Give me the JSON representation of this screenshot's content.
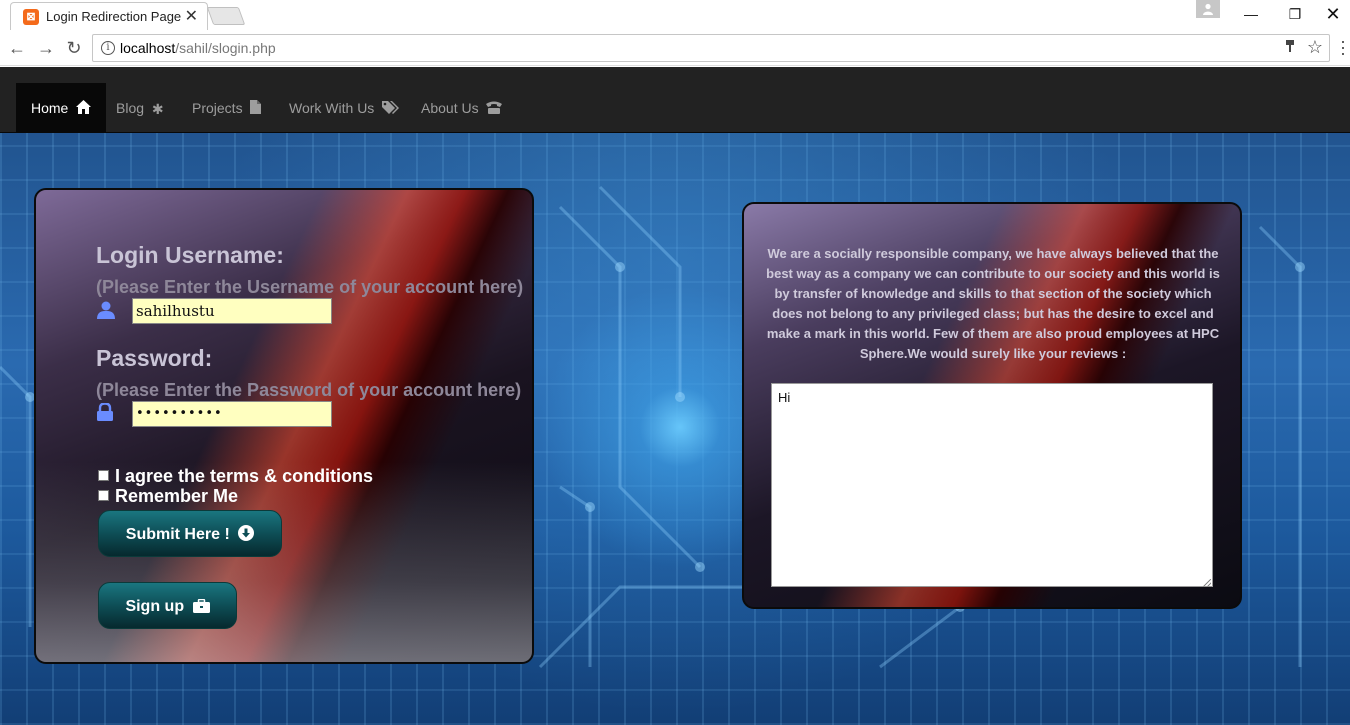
{
  "browser": {
    "tab_title": "Login Redirection Page",
    "tab_close": "✕",
    "url_host": "localhost",
    "url_path": "/sahil/slogin.php"
  },
  "navbar": {
    "items": [
      {
        "label": "Home",
        "icon": "home-icon",
        "active": true
      },
      {
        "label": "Blog",
        "icon": "asterisk-icon"
      },
      {
        "label": "Projects",
        "icon": "file-icon"
      },
      {
        "label": "Work With Us",
        "icon": "tags-icon"
      },
      {
        "label": "About Us",
        "icon": "phone-icon"
      }
    ]
  },
  "login": {
    "username_label": "Login Username:",
    "username_hint": "(Please Enter the Username of your account here)",
    "username_value": "sahilhustu",
    "password_label": "Password:",
    "password_hint": "(Please Enter the Password of your account here)",
    "password_value": "••••••••••",
    "terms_label": "I agree the terms & conditions",
    "remember_label": "Remember Me",
    "submit_label": "Submit Here !",
    "signup_label": "Sign up"
  },
  "reviews": {
    "about_text": "We are a socially responsible company, we have always believed that the best way as a company we can contribute to our society and this world is by transfer of knowledge and skills to that section of the society which does not belong to any privileged class; but has the desire to excel and make a mark in this world. Few of them are also proud employees at HPC Sphere.We would surely like your reviews :",
    "review_value": "Hi"
  },
  "colors": {
    "navbar_bg": "#222222",
    "input_bg": "#ffffc0",
    "button_accent": "#0e4e56"
  }
}
